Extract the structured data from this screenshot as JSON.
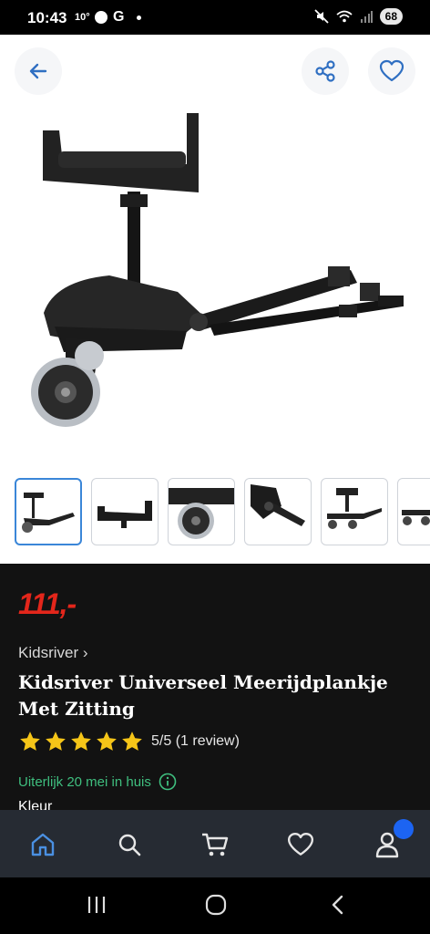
{
  "status_bar": {
    "time": "10:43",
    "temp": "10°",
    "google": "G",
    "battery": "68"
  },
  "hero": {
    "image_alt": "Kidsriver meerijdplankje met zitting"
  },
  "thumbnails": [
    {
      "name": "thumbnail-1",
      "active": true
    },
    {
      "name": "thumbnail-2",
      "active": false
    },
    {
      "name": "thumbnail-3",
      "active": false
    },
    {
      "name": "thumbnail-4",
      "active": false
    },
    {
      "name": "thumbnail-5",
      "active": false
    },
    {
      "name": "thumbnail-6",
      "active": false
    }
  ],
  "product": {
    "price": "111,-",
    "brand": "Kidsriver",
    "title": "Kidsriver Universeel Meerijdplankje Met Zitting",
    "rating_value": 5,
    "rating_max": 5,
    "rating_text": "5/5 (1 review)",
    "delivery": "Uiterlijk 20 mei in huis",
    "kleur_label": "Kleur"
  },
  "colors": {
    "price": "#e3261b",
    "star": "#f5c518",
    "delivery": "#3fbf7f",
    "nav_active": "#4a90e2",
    "badge": "#1c64f2"
  },
  "bottom_nav": [
    "home-icon",
    "search-icon",
    "cart-icon",
    "heart-icon",
    "account-icon"
  ]
}
